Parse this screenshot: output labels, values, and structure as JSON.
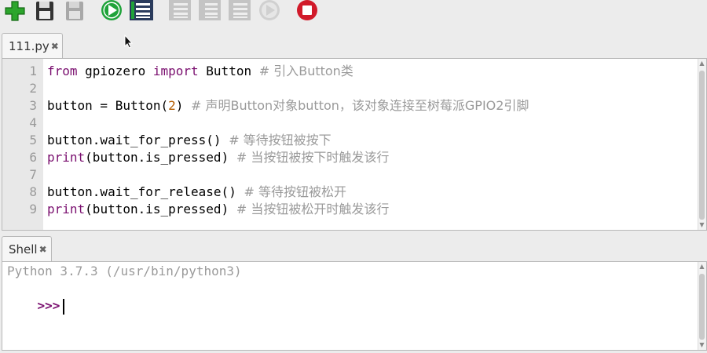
{
  "toolbar": {
    "buttons": [
      {
        "name": "new-file-icon",
        "color": "#2ca52c"
      },
      {
        "name": "save-icon",
        "color": "#333333"
      },
      {
        "name": "save-disabled-icon",
        "color": "#a8a8a8"
      },
      {
        "name": "run-icon",
        "color": "#1fa33a"
      },
      {
        "name": "debug-icon",
        "color": "#2a3b5c"
      },
      {
        "name": "step-over-icon",
        "color": "#b8b8b8"
      },
      {
        "name": "step-into-icon",
        "color": "#b8b8b8"
      },
      {
        "name": "step-out-icon",
        "color": "#b8b8b8"
      },
      {
        "name": "resume-icon",
        "color": "#c8c8c8"
      },
      {
        "name": "stop-icon",
        "color": "#d11a2a"
      }
    ]
  },
  "editor": {
    "tab_label": "111.py",
    "lines": [
      {
        "n": "1",
        "text": "from gpiozero import Button # 引入Button类"
      },
      {
        "n": "2",
        "text": ""
      },
      {
        "n": "3",
        "text": "button = Button(2) # 声明Button对象button，该对象连接至树莓派GPIO2引脚"
      },
      {
        "n": "4",
        "text": ""
      },
      {
        "n": "5",
        "text": "button.wait_for_press() # 等待按钮被按下"
      },
      {
        "n": "6",
        "text": "print(button.is_pressed) # 当按钮被按下时触发该行"
      },
      {
        "n": "7",
        "text": ""
      },
      {
        "n": "8",
        "text": "button.wait_for_release() # 等待按钮被松开"
      },
      {
        "n": "9",
        "text": "print(button.is_pressed) # 当按钮被松开时触发该行"
      }
    ]
  },
  "shell": {
    "tab_label": "Shell",
    "banner": "Python 3.7.3 (/usr/bin/python3)",
    "prompt": ">>>"
  },
  "colors": {
    "keyword": "#7a0f6f",
    "number": "#b35c00",
    "comment": "#9a9a9a",
    "banner": "#9a9a9a"
  }
}
